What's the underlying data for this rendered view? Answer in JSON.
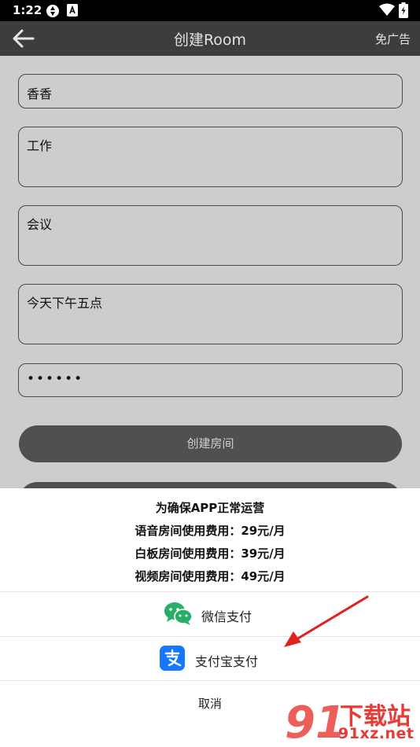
{
  "status_bar": {
    "time": "1:22"
  },
  "header": {
    "title": "创建Room",
    "right_action": "免广告"
  },
  "form": {
    "name_value": "香香",
    "field2_value": "工作",
    "field3_value": "会议",
    "field4_value": "今天下午五点",
    "password_value": "••••••",
    "create_button": "创建房间"
  },
  "sheet": {
    "notice_title": "为确保APP正常运营",
    "notice_voice": "语音房间使用费用：29元/月",
    "notice_whiteboard": "白板房间使用费用：39元/月",
    "notice_video": "视频房间使用费用：49元/月",
    "wechat_pay": "微信支付",
    "alipay": "支付宝支付",
    "cancel": "取消"
  },
  "watermark": {
    "brand": "下载站",
    "domain": "91xz.net"
  },
  "colors": {
    "wechat": "#2aae67",
    "alipay": "#1677ff",
    "arrow": "#e0211f",
    "watermark": "#e83a35"
  }
}
